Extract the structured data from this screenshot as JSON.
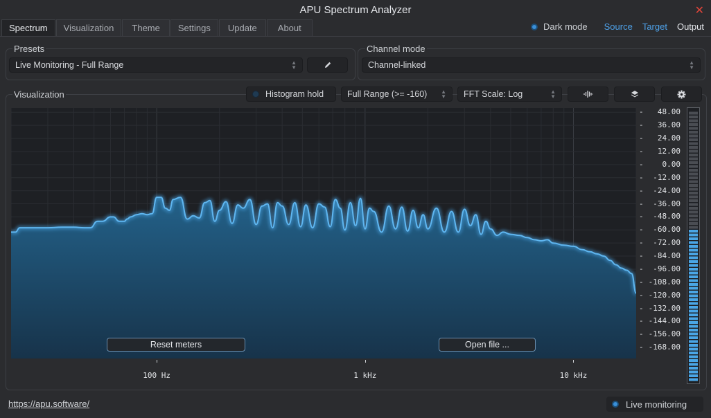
{
  "window": {
    "title": "APU Spectrum Analyzer"
  },
  "tabs": [
    {
      "label": "Spectrum",
      "active": true
    },
    {
      "label": "Visualization",
      "active": false
    },
    {
      "label": "Theme",
      "active": false
    },
    {
      "label": "Settings",
      "active": false
    },
    {
      "label": "Update",
      "active": false
    },
    {
      "label": "About",
      "active": false
    }
  ],
  "topbar": {
    "dark_mode_label": "Dark mode",
    "dark_mode_checked": true,
    "source_label": "Source",
    "target_label": "Target",
    "output_label": "Output"
  },
  "presets": {
    "label": "Presets",
    "selected": "Live Monitoring - Full Range",
    "edit_icon": "pencil-icon"
  },
  "channel_mode": {
    "label": "Channel mode",
    "selected": "Channel-linked"
  },
  "visualization": {
    "label": "Visualization",
    "histogram_hold_label": "Histogram hold",
    "histogram_hold_checked": false,
    "range_selected": "Full Range (>= -160)",
    "fft_scale_selected": "FFT Scale: Log",
    "waveform_icon": "waveform-icon",
    "layers_icon": "layers-icon",
    "gear_icon": "gear-icon",
    "reset_meters_label": "Reset meters",
    "open_file_label": "Open file ..."
  },
  "colors": {
    "accent": "#3a8fd8",
    "spectrum_line": "#4aa6e6",
    "spectrum_fill": "#1f5676",
    "close": "#e0453a"
  },
  "chart_data": {
    "type": "area",
    "x_scale": "log",
    "y_unit": "dB",
    "ylim": [
      -178,
      52
    ],
    "xlim_hz": [
      20,
      20000
    ],
    "y_ticks": [
      "48.00",
      "36.00",
      "24.00",
      "12.00",
      "0.00",
      "-12.00",
      "-24.00",
      "-36.00",
      "-48.00",
      "-60.00",
      "-72.00",
      "-84.00",
      "-96.00",
      "-108.00",
      "-120.00",
      "-132.00",
      "-144.00",
      "-156.00",
      "-168.00"
    ],
    "x_ticks": [
      {
        "hz": 100,
        "label": "100 Hz"
      },
      {
        "hz": 1000,
        "label": "1 kHz"
      },
      {
        "hz": 10000,
        "label": "10 kHz"
      }
    ],
    "grid": true,
    "series": [
      {
        "x": [
          20,
          21,
          22,
          25,
          30,
          35,
          40,
          45,
          48,
          52,
          55,
          60,
          62,
          66,
          70,
          72,
          75,
          80,
          85,
          90,
          95,
          100,
          105,
          110,
          115,
          120,
          130,
          140,
          150,
          160,
          170,
          180,
          190,
          200,
          215,
          230,
          245,
          260,
          280,
          300,
          320,
          340,
          360,
          380,
          400,
          430,
          460,
          490,
          520,
          560,
          600,
          640,
          680,
          720,
          760,
          800,
          850,
          900,
          950,
          1000,
          1050,
          1100,
          1200,
          1300,
          1400,
          1500,
          1600,
          1700,
          1800,
          1900,
          2000,
          2200,
          2400,
          2600,
          2800,
          3000,
          3200,
          3400,
          3600,
          3800,
          4000,
          4300,
          4600,
          5000,
          5500,
          6000,
          6500,
          7000,
          7500,
          8000,
          9000,
          10000,
          11000,
          12000,
          13000,
          14000,
          15000,
          16000,
          17000,
          18000,
          19000,
          20000
        ],
        "y": [
          -62,
          -62,
          -58,
          -58,
          -58,
          -57.5,
          -57.5,
          -58,
          -58,
          -52,
          -52,
          -48,
          -48,
          -52,
          -52,
          -50,
          -48,
          -46,
          -45,
          -46,
          -45,
          -30,
          -30,
          -40,
          -42,
          -32,
          -30,
          -50,
          -47,
          -49,
          -35,
          -33,
          -52,
          -42,
          -34,
          -54,
          -37,
          -40,
          -32,
          -55,
          -38,
          -36,
          -58,
          -35,
          -38,
          -55,
          -35,
          -57,
          -37,
          -58,
          -36,
          -39,
          -57,
          -32,
          -40,
          -60,
          -35,
          -56,
          -31,
          -59,
          -40,
          -43,
          -62,
          -38,
          -59,
          -39,
          -61,
          -42,
          -58,
          -46,
          -59,
          -40,
          -62,
          -43,
          -62,
          -41,
          -56,
          -46,
          -64,
          -52,
          -59,
          -65,
          -62,
          -64,
          -65,
          -67,
          -69,
          -70,
          -69,
          -72,
          -74,
          -75,
          -78,
          -80,
          -82,
          -84,
          -88,
          -92,
          -95,
          -97,
          -100,
          -118
        ]
      }
    ]
  },
  "footer": {
    "url": "https://apu.software/",
    "live_monitoring_label": "Live monitoring",
    "live_monitoring_checked": true
  },
  "meter": {
    "level_fraction": 0.57
  }
}
